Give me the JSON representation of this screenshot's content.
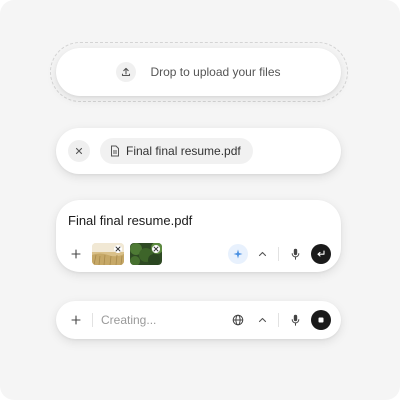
{
  "upload": {
    "icon": "upload-icon",
    "label": "Drop to upload your files"
  },
  "file_chip": {
    "remove_icon": "close-icon",
    "file_icon": "document-icon",
    "file_name": "Final final resume.pdf"
  },
  "composer": {
    "title": "Final final resume.pdf",
    "add_icon": "plus-icon",
    "attachments": [
      {
        "name": "wheat-field-thumbnail",
        "remove_icon": "close-icon"
      },
      {
        "name": "green-foliage-thumbnail",
        "remove_icon": "close-icon"
      }
    ],
    "sparkle_icon": "sparkle-icon",
    "chevron_icon": "chevron-up-icon",
    "mic_icon": "microphone-icon",
    "send_icon": "enter-icon",
    "accent": "#4a90e2"
  },
  "creating": {
    "add_icon": "plus-icon",
    "placeholder": "Creating...",
    "globe_icon": "globe-icon",
    "chevron_icon": "chevron-up-icon",
    "mic_icon": "microphone-icon",
    "stop_icon": "stop-icon"
  },
  "colors": {
    "background": "#f5f5f5",
    "card": "#ffffff",
    "dark_button": "#1a1a1a",
    "sparkle_bg": "#e8f1fd"
  }
}
